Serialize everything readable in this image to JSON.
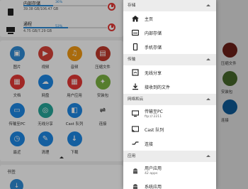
{
  "colors": {
    "accent": "#2e8bd6",
    "warn": "#e53935"
  },
  "storage": [
    {
      "name": "内部存储",
      "percent": "36%",
      "fill": 0.36,
      "size": "39.38 GB/106.47 GB",
      "icon": "phone-icon"
    },
    {
      "name": "通程",
      "percent": "53%",
      "fill": 0.53,
      "size": "4.75 GB/7.29 GB",
      "icon": "computer-icon"
    }
  ],
  "grid": [
    {
      "label": "图片",
      "color": "#2e8bd6",
      "glyph": "▣",
      "icon": "image-icon"
    },
    {
      "label": "视频",
      "color": "#d84339",
      "glyph": "▶",
      "icon": "video-icon"
    },
    {
      "label": "音频",
      "color": "#f39a14",
      "glyph": "♫",
      "icon": "headphone-icon"
    },
    {
      "label": "压缩文件",
      "color": "#c0392b",
      "glyph": "▤",
      "icon": "archive-icon"
    },
    {
      "label": "文档",
      "color": "#e53935",
      "glyph": "▦",
      "icon": "document-icon"
    },
    {
      "label": "网盘",
      "color": "#1e88e5",
      "glyph": "☁",
      "icon": "cloud-icon"
    },
    {
      "label": "用户应用",
      "color": "#e53935",
      "glyph": "▦",
      "icon": "apps-icon"
    },
    {
      "label": "安装包",
      "color": "#7cb342",
      "glyph": "✦",
      "icon": "android-icon"
    },
    {
      "label": "传输至PC",
      "color": "#1e88e5",
      "glyph": "▭",
      "icon": "pc-transfer-icon"
    },
    {
      "label": "无线分享",
      "color": "#26a69a",
      "glyph": "◎",
      "icon": "wifi-share-icon"
    },
    {
      "label": "Cast 队列",
      "color": "#1e88e5",
      "glyph": "◧",
      "icon": "cast-icon"
    },
    {
      "label": "连接",
      "color": "#fff",
      "glyph": "⇌",
      "icon": "connect-icon",
      "dark": true
    },
    {
      "label": "最近",
      "color": "#1e88e5",
      "glyph": "◷",
      "icon": "clock-icon"
    },
    {
      "label": "清理",
      "color": "#1e88e5",
      "glyph": "✎",
      "icon": "clean-icon"
    },
    {
      "label": "下载",
      "color": "#1e88e5",
      "glyph": "↓",
      "icon": "download-icon"
    }
  ],
  "bookmarks": {
    "title": "书签",
    "icon": "folder-download-icon"
  },
  "drawer": {
    "sections": [
      {
        "title": "存储",
        "items": [
          {
            "label": "主页",
            "icon": "home-icon"
          },
          {
            "label": "内部存储",
            "icon": "storage-icon"
          },
          {
            "label": "手机存储",
            "icon": "phone-icon"
          }
        ]
      },
      {
        "title": "传输",
        "items": [
          {
            "label": "无线分享",
            "icon": "wifi-share-icon"
          },
          {
            "label": "接收到的文件",
            "icon": "download-icon"
          }
        ]
      },
      {
        "title": "网络和云",
        "items": [
          {
            "label": "传输至PC",
            "sub": "ftp://:2211",
            "icon": "pc-transfer-icon"
          },
          {
            "label": "Cast 队列",
            "icon": "cast-icon"
          },
          {
            "label": "连接",
            "icon": "connect-icon"
          }
        ]
      },
      {
        "title": "应用",
        "items": [
          {
            "label": "用户应用",
            "sub": "42 apps",
            "icon": "android-icon"
          },
          {
            "label": "系统应用",
            "icon": "android-icon"
          }
        ]
      }
    ]
  },
  "background_right": [
    {
      "label": "压缩文件",
      "color": "#6b1f18"
    },
    {
      "label": "安装包",
      "color": "#46662a"
    },
    {
      "label": "连接",
      "color": "#0d5a96"
    }
  ]
}
